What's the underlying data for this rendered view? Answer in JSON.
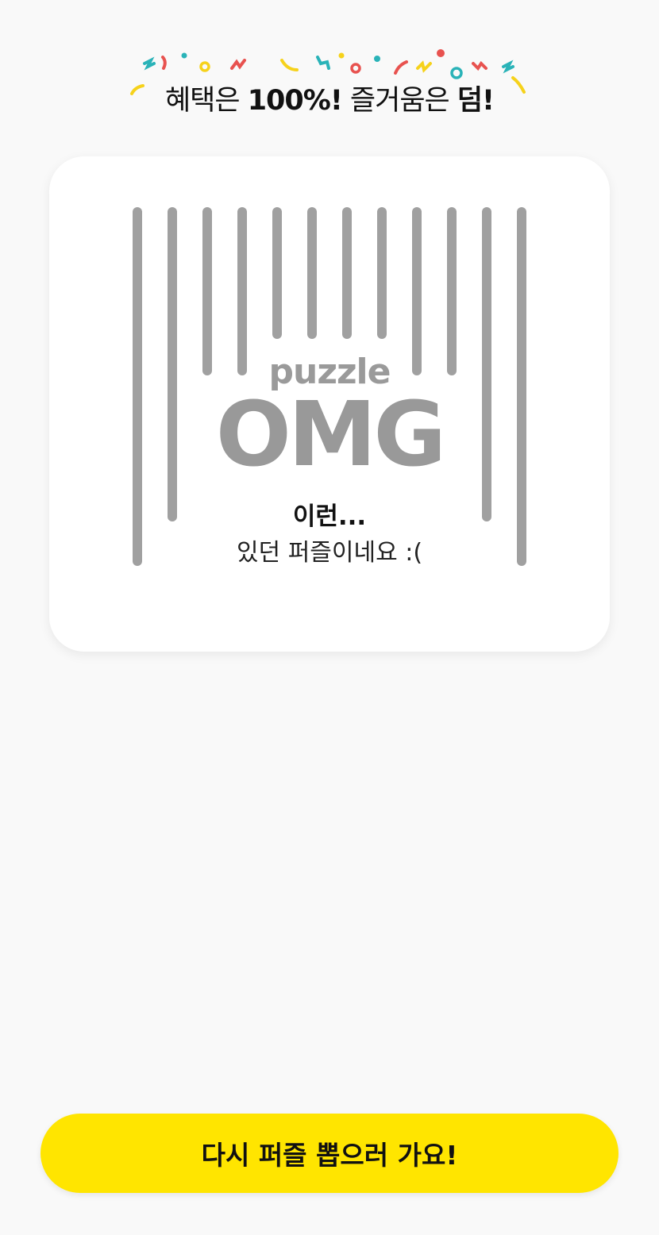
{
  "header": {
    "headline_part1": "혜택은 ",
    "headline_part2": "100%!",
    "headline_part3": " 즐거움은 ",
    "headline_part4": "덤!"
  },
  "result_card": {
    "logo_small": "puzzle",
    "logo_large": "OMG",
    "message_title": "이런...",
    "message_body": "있던 퍼즐이네요 :("
  },
  "actions": {
    "retry_label": "다시 퍼즐 뽑으러 가요!"
  },
  "colors": {
    "background": "#f9f9f9",
    "accent_yellow": "#ffe500",
    "bar_gray": "#a0a0a0",
    "confetti_teal": "#2ab3b8",
    "confetti_red": "#e8524f",
    "confetti_yellow": "#f6d21b"
  }
}
